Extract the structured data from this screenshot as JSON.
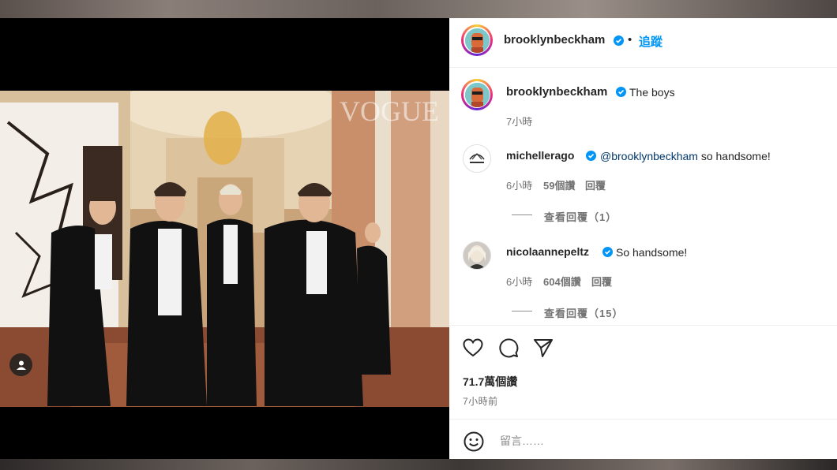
{
  "post": {
    "author": "brooklynbeckham",
    "follow_label": "追蹤",
    "separator": "•",
    "caption": "The boys",
    "caption_time": "7小時",
    "likes": "71.7萬個讚",
    "posted_ago": "7小時前",
    "photo_watermark": "VOGUE"
  },
  "comments": [
    {
      "username": "michellerago",
      "mention": "@brooklynbeckham",
      "text": " so handsome!",
      "time": "6小時",
      "likes": "59個讚",
      "reply_label": "回覆",
      "view_replies": "查看回覆（1）"
    },
    {
      "username": "nicolaannepeltz",
      "mention": "",
      "text": "So handsome!",
      "time": "6小時",
      "likes": "604個讚",
      "reply_label": "回覆",
      "view_replies": "查看回覆（15）"
    }
  ],
  "composer": {
    "placeholder": "留言……"
  },
  "icons": {
    "like": "heart-icon",
    "comment": "comment-bubble-icon",
    "share": "paper-plane-icon",
    "emoji": "emoji-icon",
    "verified": "verified-badge-icon",
    "user_tags": "user-tag-icon"
  },
  "colors": {
    "accent": "#0095f6",
    "verified": "#0095f6",
    "text": "#262626",
    "secondary": "#737373"
  }
}
